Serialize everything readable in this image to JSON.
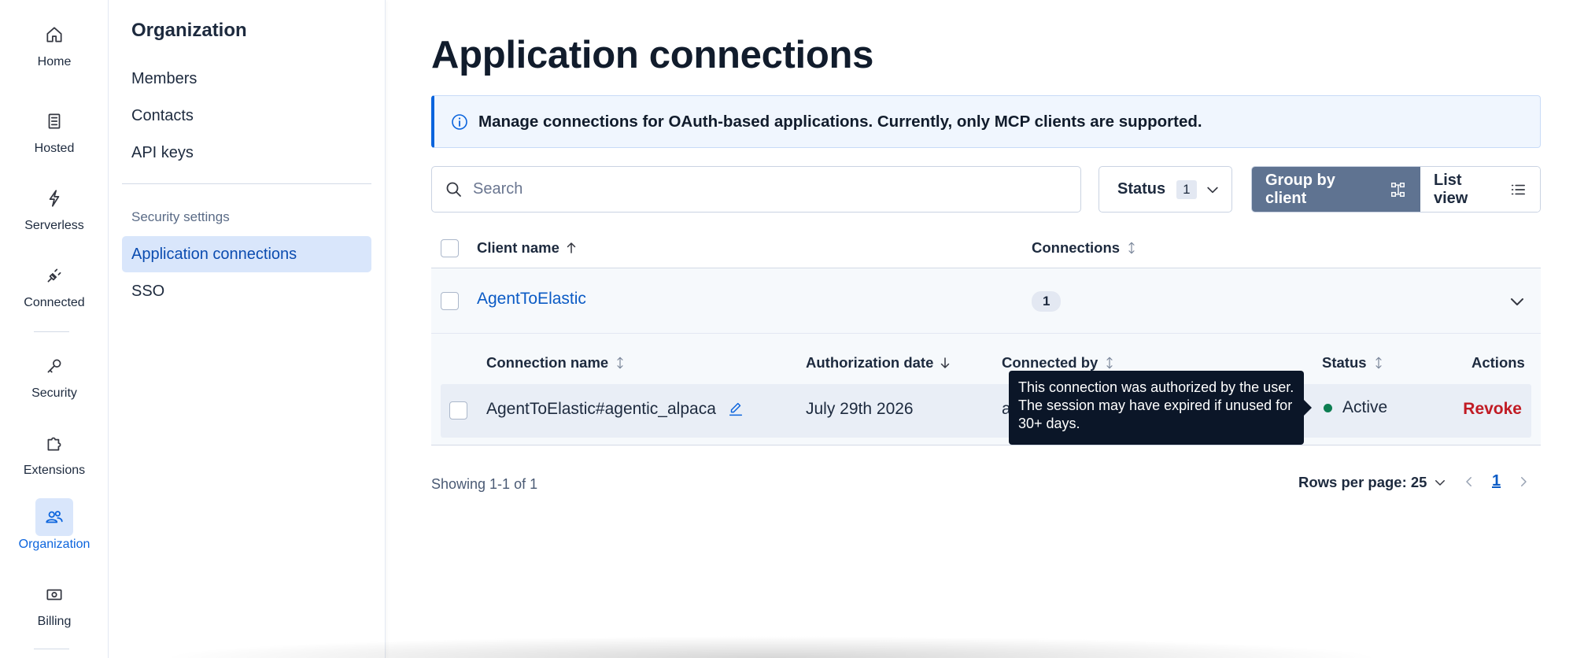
{
  "rail": {
    "items": [
      {
        "label": "Home",
        "icon": "home-icon"
      },
      {
        "label": "Hosted",
        "icon": "server-icon"
      },
      {
        "label": "Serverless",
        "icon": "bolt-icon"
      },
      {
        "label": "Connected",
        "icon": "plug-icon"
      },
      {
        "label": "Security",
        "icon": "key-icon"
      },
      {
        "label": "Extensions",
        "icon": "puzzle-icon"
      },
      {
        "label": "Organization",
        "icon": "users-icon",
        "active": true
      },
      {
        "label": "Billing",
        "icon": "billing-icon"
      }
    ]
  },
  "subnav": {
    "title": "Organization",
    "links": [
      "Members",
      "Contacts",
      "API keys"
    ],
    "section_label": "Security settings",
    "security_links": [
      "Application connections",
      "SSO"
    ],
    "active": "Application connections"
  },
  "main": {
    "title": "Application connections",
    "callout": "Manage connections for OAuth-based applications. Currently, only MCP clients are supported.",
    "search": {
      "placeholder": "Search",
      "value": ""
    },
    "status_filter": {
      "label": "Status",
      "count": "1"
    },
    "view_toggle": {
      "group_label": "Group by client",
      "list_label": "List view",
      "selected": "Group by client"
    }
  },
  "table": {
    "columns": {
      "client_name": "Client name",
      "connections": "Connections"
    },
    "group": {
      "client": "AgentToElastic",
      "connections": "1"
    },
    "sub_columns": {
      "connection_name": "Connection name",
      "authorization_date": "Authorization date",
      "connected_by": "Connected by",
      "status": "Status",
      "actions": "Actions"
    },
    "rows": [
      {
        "connection_name": "AgentToElastic#agentic_alpaca",
        "authorization_date": "July 29th 2026",
        "connected_by": "a",
        "status": "Active",
        "action": "Revoke"
      }
    ]
  },
  "tooltip": "This connection was authorized by the user. The session may have expired if unused for 30+ days.",
  "footer": {
    "showing": "Showing 1-1 of 1",
    "rows_per_page": "Rows per page: 25",
    "current_page": "1"
  },
  "colors": {
    "accent": "#0b64dd",
    "active_status": "#0d7d51",
    "danger": "#c11b24",
    "toggle_on": "#5f7391"
  }
}
